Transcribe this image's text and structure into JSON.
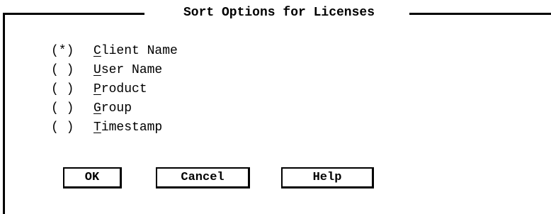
{
  "dialog": {
    "title": "Sort Options for Licenses"
  },
  "sort_options": [
    {
      "marker": "(*)",
      "hotkey": "C",
      "rest": "lient Name",
      "selected": true
    },
    {
      "marker": "( )",
      "hotkey": "U",
      "rest": "ser Name",
      "selected": false
    },
    {
      "marker": "( )",
      "hotkey": "P",
      "rest": "roduct",
      "selected": false
    },
    {
      "marker": "( )",
      "hotkey": "G",
      "rest": "roup",
      "selected": false
    },
    {
      "marker": "( )",
      "hotkey": "T",
      "rest": "imestamp",
      "selected": false
    }
  ],
  "buttons": {
    "ok": "OK",
    "cancel": "Cancel",
    "help": "Help"
  }
}
